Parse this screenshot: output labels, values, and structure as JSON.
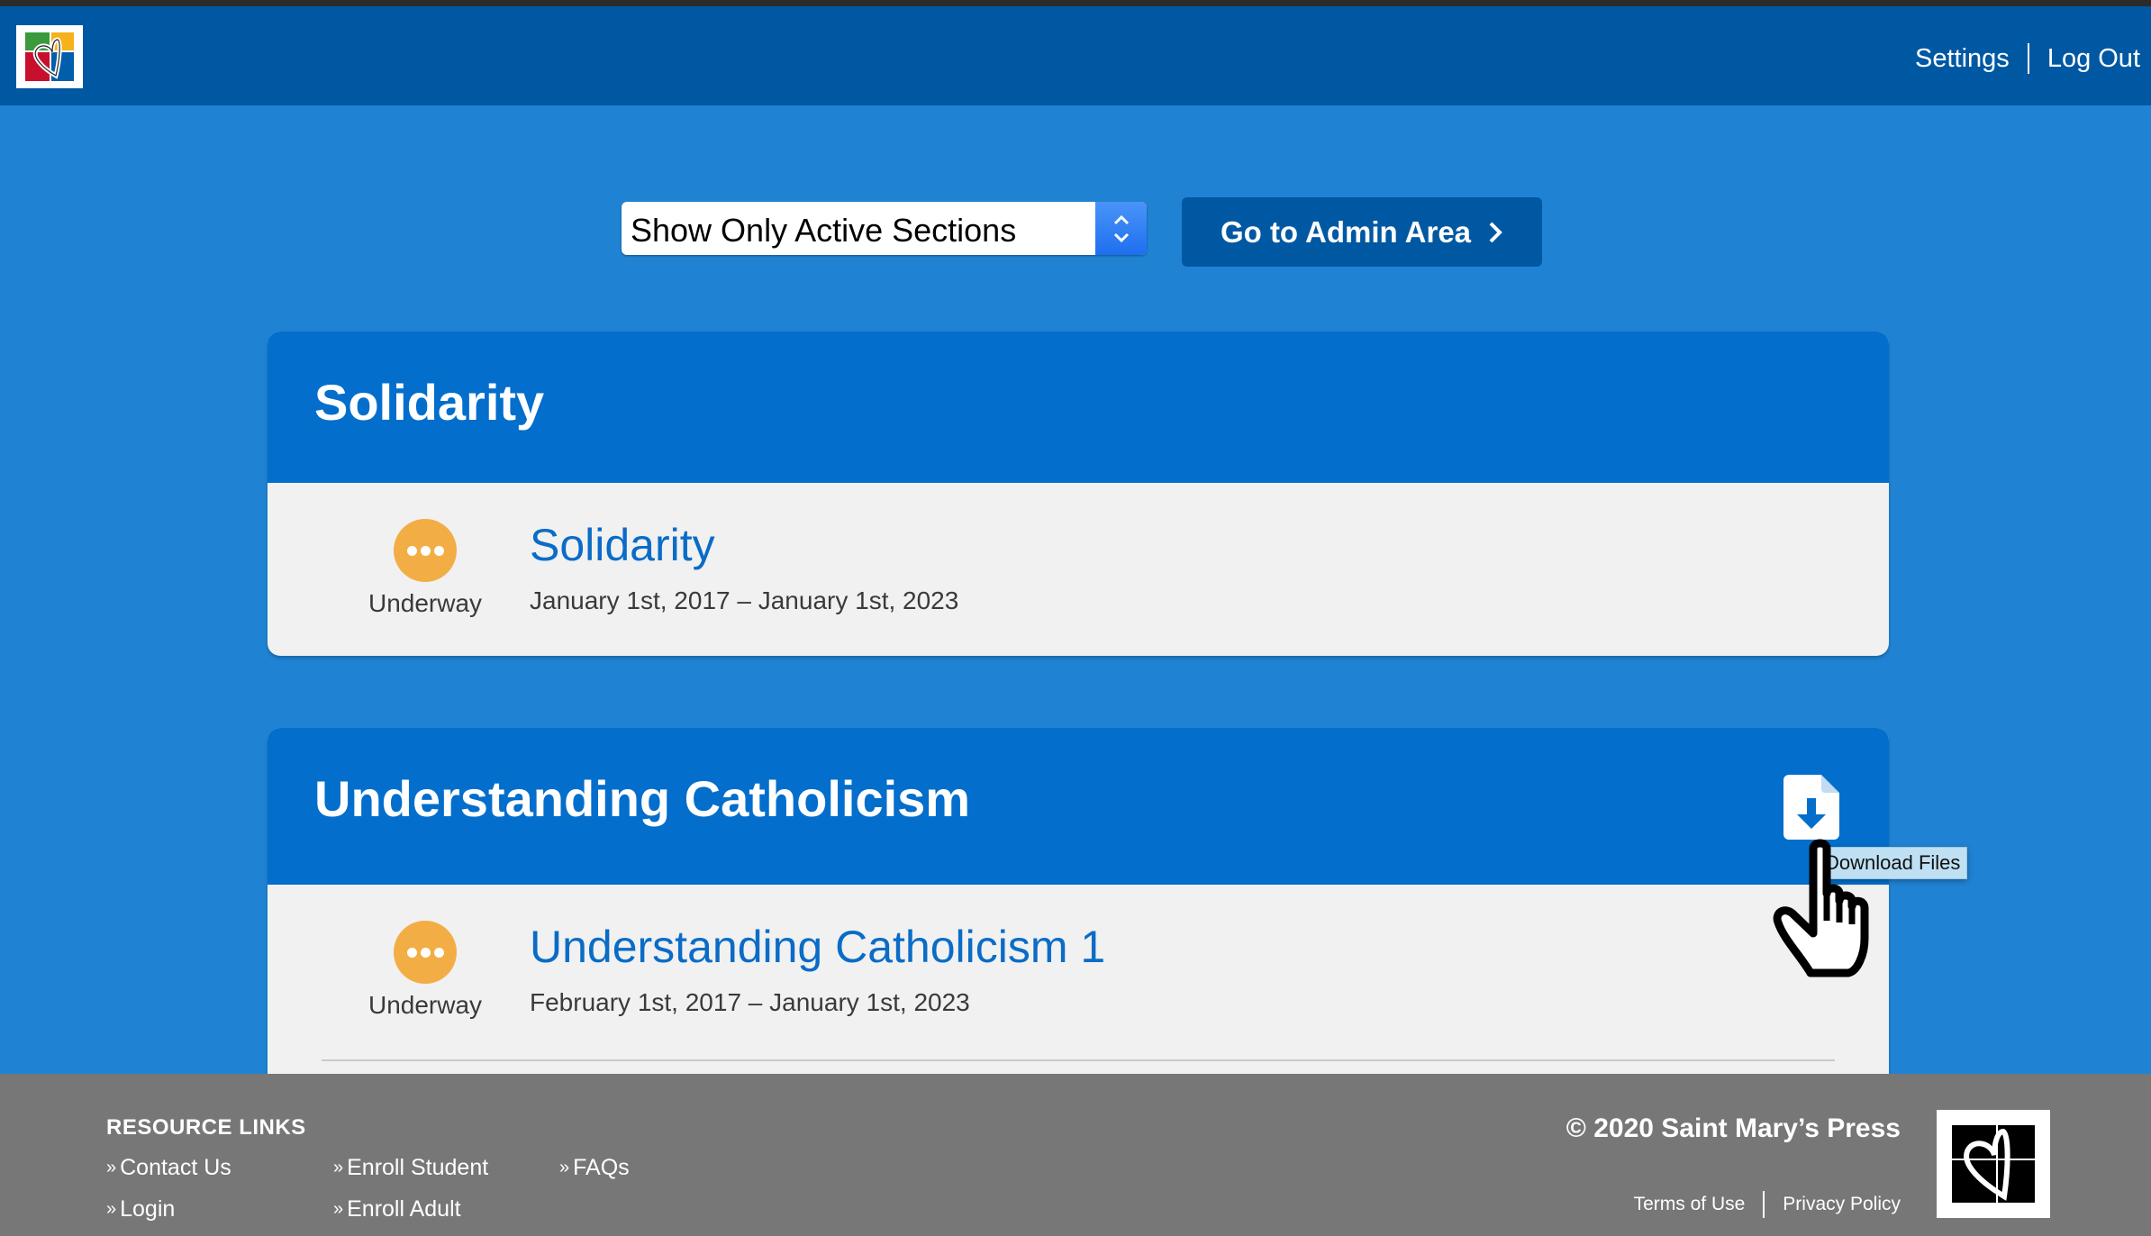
{
  "header": {
    "logo_icon": "saint-marys-press-heart-logo",
    "links": [
      {
        "label": "Settings"
      },
      {
        "label": "Log Out"
      }
    ]
  },
  "controls": {
    "section_filter": {
      "selected": "Show Only Active Sections",
      "icon": "up-down-chevron-icon"
    },
    "admin_button": {
      "label": "Go to Admin Area",
      "icon": "chevron-right-icon"
    }
  },
  "colors": {
    "page_bg": "#2082d2",
    "header_bg": "#0058a3",
    "card_header_bg": "#036ecb",
    "card_body_bg": "#f1f1f1",
    "status_underway": "#f2ae45",
    "link_blue": "#0a6cc6",
    "footer_bg": "#777777"
  },
  "courses": [
    {
      "title": "Solidarity",
      "sections": [
        {
          "status": "Underway",
          "status_icon": "ellipsis-circle-icon",
          "name": "Solidarity",
          "dates": "January 1st, 2017 – January 1st, 2023"
        }
      ]
    },
    {
      "title": "Understanding Catholicism",
      "download_icon": "file-download-icon",
      "download_tooltip": "Download Files",
      "sections": [
        {
          "status": "Underway",
          "status_icon": "ellipsis-circle-icon",
          "name": "Understanding Catholicism 1",
          "dates": "February 1st, 2017 – January 1st, 2023"
        }
      ]
    }
  ],
  "footer": {
    "resource_title": "RESOURCE LINKS",
    "links": [
      {
        "label": "Contact Us"
      },
      {
        "label": "Login"
      },
      {
        "label": "Enroll Student"
      },
      {
        "label": "Enroll Adult"
      },
      {
        "label": "FAQs"
      }
    ],
    "copyright": "© 2020 Saint Mary’s Press",
    "legal": [
      {
        "label": "Terms of Use"
      },
      {
        "label": "Privacy Policy"
      }
    ]
  }
}
